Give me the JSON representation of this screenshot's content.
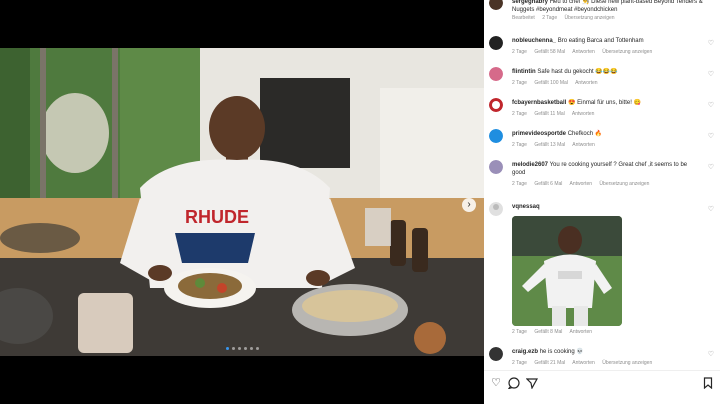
{
  "post": {
    "caption_user": "sergegnabry",
    "caption_text": "Heu to chef 👨‍🍳 Diese new plant-based Beyond Tenders & Nuggets #beyondmeat #beyondchicken",
    "caption_meta": [
      "Bearbeitet",
      "2 Tage",
      "Übersetzung anzeigen"
    ]
  },
  "comments": [
    {
      "user": "nobleuchenna_",
      "text": "Bro eating Barca and Tottenham",
      "meta": [
        "2 Tage",
        "Gefällt 58 Mal",
        "Antworten",
        "Übersetzung anzeigen"
      ]
    },
    {
      "user": "flintintin",
      "text": "Safe hast du gekocht 😂😂😂",
      "meta": [
        "2 Tage",
        "Gefällt 100 Mal",
        "Antworten"
      ]
    },
    {
      "user": "fcbayernbasketball",
      "text": "😍 Einmal für uns, bitte! 😋",
      "meta": [
        "2 Tage",
        "Gefällt 11 Mal",
        "Antworten"
      ]
    },
    {
      "user": "primevideosportde",
      "text": "Chefkoch 🔥",
      "meta": [
        "2 Tage",
        "Gefällt 13 Mal",
        "Antworten"
      ]
    },
    {
      "user": "melodie2607",
      "text": "You re cooking yourself ? Great chef ,it seems to be good",
      "meta": [
        "2 Tage",
        "Gefällt 6 Mal",
        "Antworten",
        "Übersetzung anzeigen"
      ]
    },
    {
      "user": "vqnessaq",
      "text": "",
      "meta": [
        "2 Tage",
        "Gefällt 8 Mal",
        "Antworten"
      ]
    },
    {
      "user": "craig.ezb",
      "text": "he is cooking 💀",
      "meta": [
        "2 Tage",
        "Gefällt 21 Mal",
        "Antworten",
        "Übersetzung anzeigen"
      ]
    }
  ],
  "icons": {
    "heart": "heart-icon",
    "comment": "comment-icon",
    "share": "share-icon",
    "save": "bookmark-icon",
    "next": "chevron-right-icon"
  },
  "colors": {
    "accent": "#3897f0",
    "text": "#262626",
    "muted": "#8e8e8e"
  }
}
